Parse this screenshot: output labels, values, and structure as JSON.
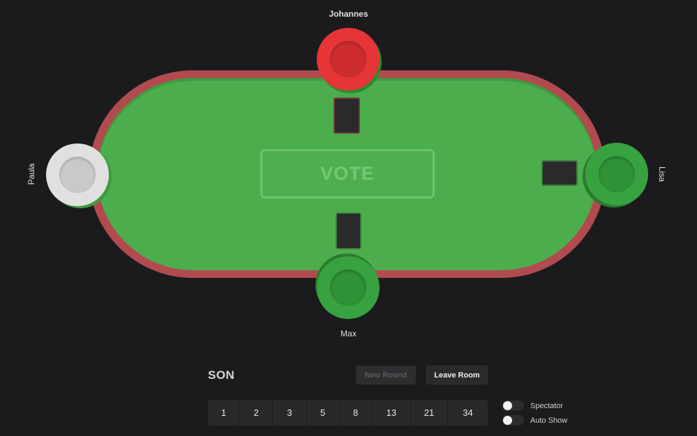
{
  "table": {
    "center_label": "VOTE",
    "colors": {
      "felt": "#4cad4c",
      "rim": "#b14b4f"
    }
  },
  "players": {
    "top": {
      "name": "Johannes",
      "chip_color": "#e53536"
    },
    "bottom": {
      "name": "Max",
      "chip_color": "#37a23f"
    },
    "left": {
      "name": "Paula",
      "chip_color": "#e0e0e0"
    },
    "right": {
      "name": "Lisa",
      "chip_color": "#37a23f"
    }
  },
  "controls": {
    "room_name": "SON",
    "new_round_label": "New Round",
    "leave_room_label": "Leave Room",
    "vote_cards": [
      "1",
      "2",
      "3",
      "5",
      "8",
      "13",
      "21",
      "34"
    ],
    "spectator_label": "Spectator",
    "auto_show_label": "Auto Show"
  }
}
